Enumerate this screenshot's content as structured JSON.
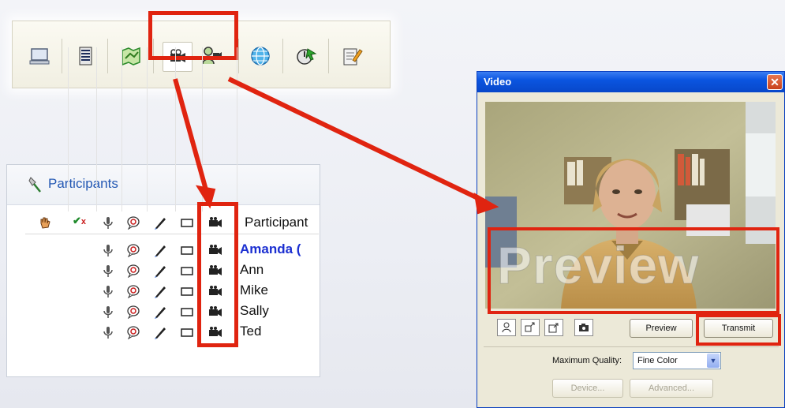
{
  "toolbar": {
    "buttons": [
      {
        "icon": "computer-icon"
      },
      {
        "icon": "list-icon"
      },
      {
        "icon": "map-icon"
      },
      {
        "icon": "video-camera-icon",
        "pressed": true
      },
      {
        "icon": "video-participants-icon"
      },
      {
        "icon": "globe-icon"
      },
      {
        "icon": "pointer-icon"
      },
      {
        "icon": "notes-icon"
      }
    ],
    "highlight_color": "#e02410"
  },
  "participants": {
    "title": "Participants",
    "column_header": "Participant",
    "rows": [
      {
        "name": "Amanda (",
        "self": true
      },
      {
        "name": "Ann",
        "self": false
      },
      {
        "name": "Mike",
        "self": false
      },
      {
        "name": "Sally",
        "self": false
      },
      {
        "name": "Ted",
        "self": false
      }
    ]
  },
  "video_window": {
    "title": "Video",
    "close_label": "✕",
    "overlay_text": "Preview",
    "buttons": {
      "preview": "Preview",
      "transmit": "Transmit",
      "device": "Device...",
      "advanced": "Advanced..."
    },
    "quality_label": "Maximum Quality:",
    "quality_value": "Fine Color"
  },
  "colors": {
    "annotation_red": "#e02410",
    "xp_title": "#0a55e0",
    "link_blue": "#2358b3"
  }
}
